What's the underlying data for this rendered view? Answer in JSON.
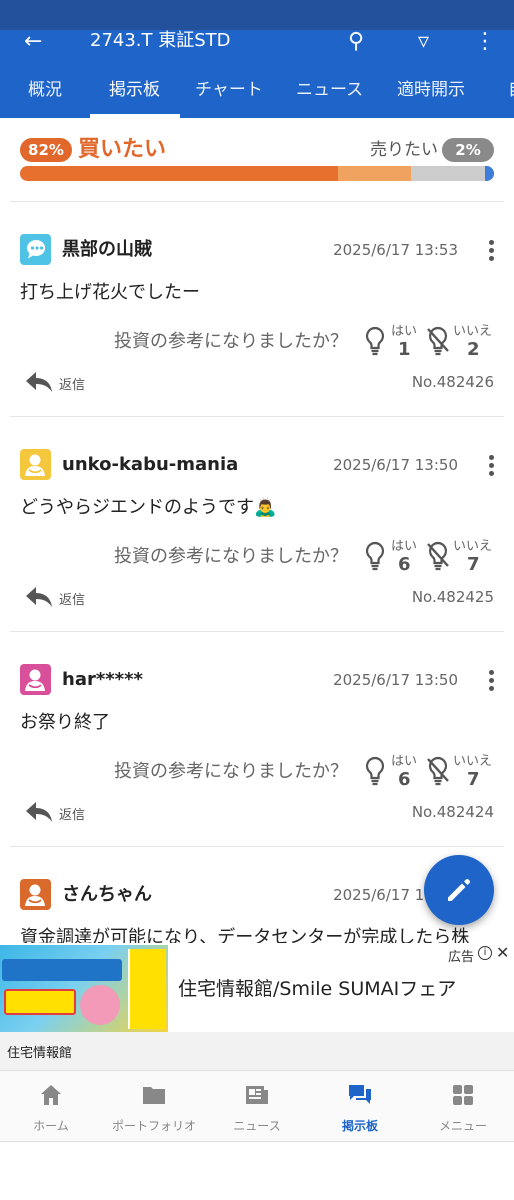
{
  "header": {
    "ticker": "2743.T 東証STD",
    "tabs": [
      "概況",
      "掲示板",
      "チャート",
      "ニュース",
      "適時開示",
      "自"
    ],
    "active_tab": 1
  },
  "sentiment": {
    "buy_percent": "82%",
    "buy_label": "買いたい",
    "sell_label": "売りたい",
    "sell_percent": "2%",
    "segments": [
      {
        "share": 0.67,
        "color": "#e8702e"
      },
      {
        "share": 0.155,
        "color": "#f0a35e"
      },
      {
        "share": 0.155,
        "color": "#cccccc"
      },
      {
        "share": 0.02,
        "color": "#3b7dd8"
      }
    ]
  },
  "posts": [
    {
      "username": "黒部の山賊",
      "time": "2025/6/17 13:53",
      "text": "打ち上げ花火でしたー",
      "question": "投資の参考になりましたか？",
      "yes_label": "はい",
      "yes_count": "1",
      "no_label": "いいえ",
      "no_count": "2",
      "reply_label": "返信",
      "number": "No.482426",
      "avatar_color": "#4fc3e6",
      "avatar_icon": "chat-bubble-avatar"
    },
    {
      "username": "unko-kabu-mania",
      "time": "2025/6/17 13:50",
      "text": "どうやらジエンドのようです🙇‍♂️",
      "question": "投資の参考になりましたか？",
      "yes_label": "はい",
      "yes_count": "6",
      "no_label": "いいえ",
      "no_count": "7",
      "reply_label": "返信",
      "number": "No.482425",
      "avatar_color": "#f5c73d",
      "avatar_icon": "person-avatar"
    },
    {
      "username": "har*****",
      "time": "2025/6/17 13:50",
      "text": "お祭り終了",
      "question": "投資の参考になりましたか？",
      "yes_label": "はい",
      "yes_count": "6",
      "no_label": "いいえ",
      "no_count": "7",
      "reply_label": "返信",
      "number": "No.482424",
      "avatar_color": "#d94f9a",
      "avatar_icon": "person-avatar"
    },
    {
      "username": "さんちゃん",
      "time": "2025/6/17 13:50",
      "text": "資金調達が可能になり、データセンターが完成したら株",
      "avatar_color": "#d96a2b",
      "avatar_icon": "person-avatar"
    }
  ],
  "ad": {
    "tag": "広告",
    "title": "住宅情報館/Smile SUMAIフェア",
    "advertiser": "住宅情報館"
  },
  "bottom_nav": [
    {
      "label": "ホーム",
      "icon": "home-icon"
    },
    {
      "label": "ポートフォリオ",
      "icon": "folder-icon"
    },
    {
      "label": "ニュース",
      "icon": "news-icon"
    },
    {
      "label": "掲示板",
      "icon": "board-icon",
      "active": true
    },
    {
      "label": "メニュー",
      "icon": "menu-grid-icon"
    }
  ],
  "colors": {
    "brand_blue": "#1f64c8",
    "buy_orange": "#e1672b",
    "sell_gray": "#8a8a8a"
  }
}
